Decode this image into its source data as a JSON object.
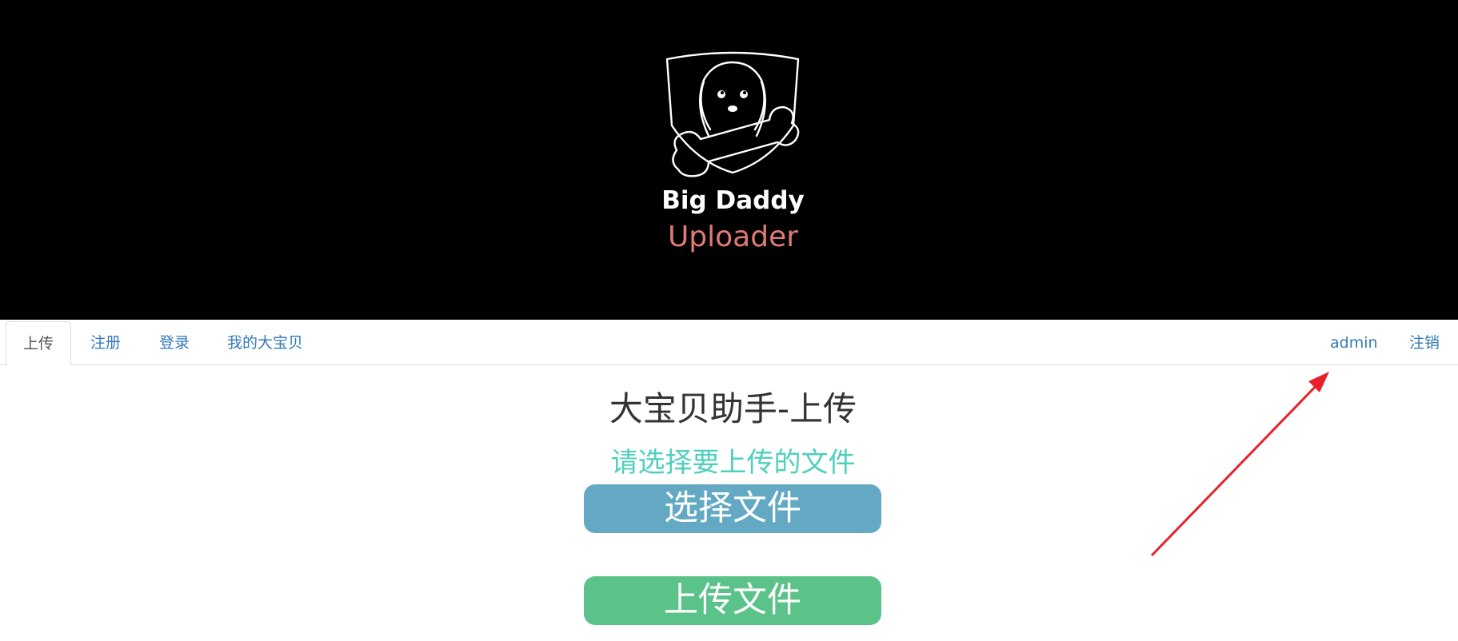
{
  "brand": {
    "title": "Big Daddy",
    "subtitle": "Uploader",
    "title_color": "#ffffff",
    "subtitle_color": "#e07a74",
    "logo_icon": "dog-with-bone-shield-icon"
  },
  "nav": {
    "left": [
      {
        "label": "上传",
        "active": true
      },
      {
        "label": "注册",
        "active": false
      },
      {
        "label": "登录",
        "active": false
      },
      {
        "label": "我的大宝贝",
        "active": false
      }
    ],
    "right": [
      {
        "label": "admin"
      },
      {
        "label": "注销"
      }
    ],
    "link_color": "#337ab7"
  },
  "main": {
    "heading": "大宝贝助手-上传",
    "subheading": "请选择要上传的文件",
    "subheading_color": "#4dd0bd",
    "choose_button_label": "选择文件",
    "choose_button_color": "#63a9c3",
    "upload_button_label": "上传文件",
    "upload_button_color": "#5bc38a"
  },
  "annotation": {
    "arrow_icon": "red-arrow-annotation",
    "color": "#e8202a"
  }
}
